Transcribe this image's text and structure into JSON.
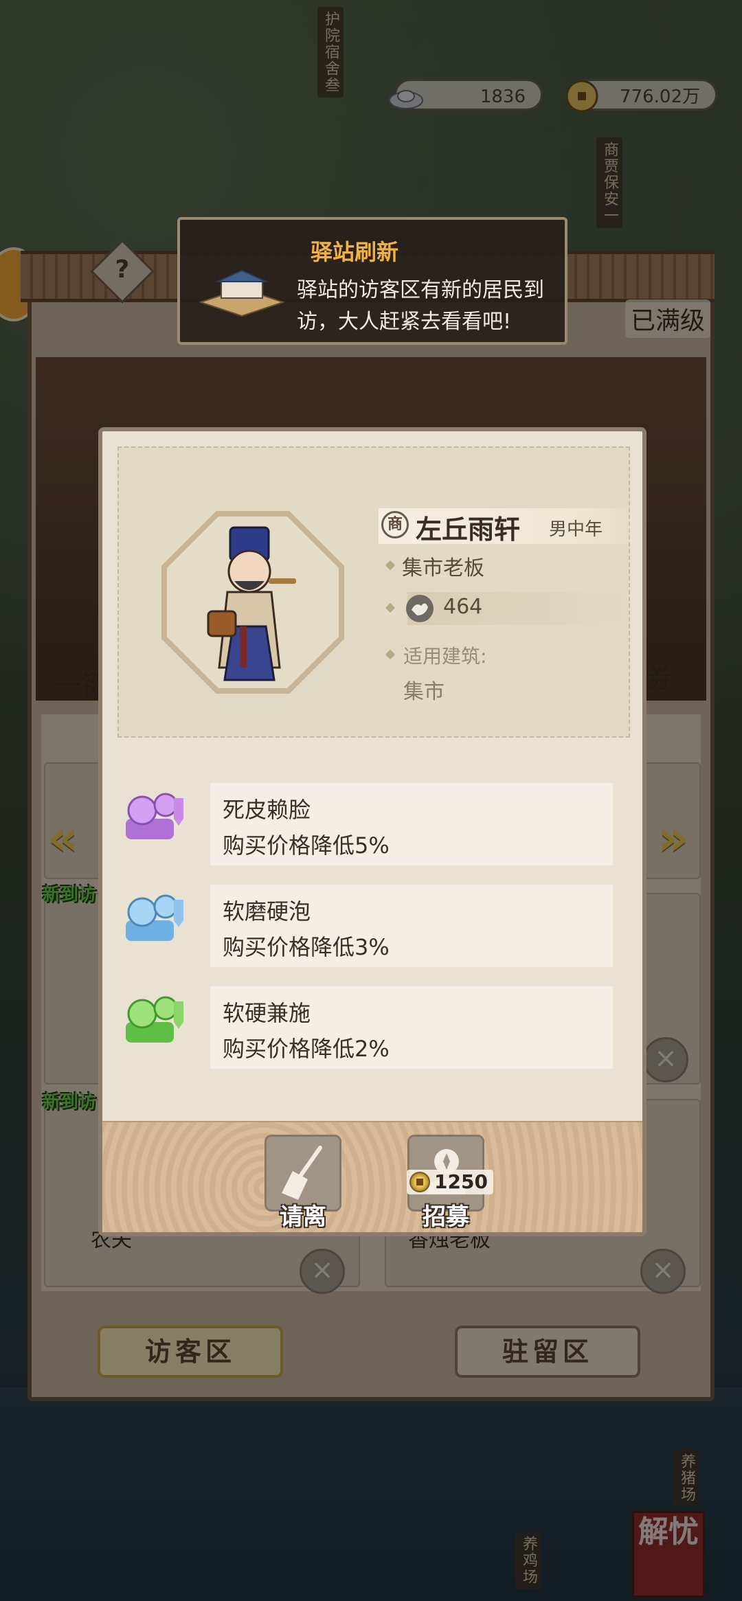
{
  "map": {
    "labels": {
      "guard_dorm": "护院宿舍叁",
      "merchant_security": "商贾保安一",
      "pig_farm": "养猪场",
      "chicken_farm": "养鸡场"
    },
    "corner_logo": "解忧"
  },
  "currency": {
    "silver": "1836",
    "copper": "776.02万"
  },
  "notification": {
    "title": "驿站刷新",
    "text": "驿站的访客区有新的居民到访，大人赶紧去看看吧!"
  },
  "panel": {
    "help": "?",
    "max_level": "已满级",
    "left_partial": "一键",
    "right_partial": "券",
    "new_badge": "新到访",
    "slot_left_label": "农夫",
    "slot_right_label": "香烛老板",
    "tabs": [
      {
        "label": "访客区",
        "active": true
      },
      {
        "label": "驻留区",
        "active": false
      }
    ]
  },
  "visitor": {
    "seal": "商",
    "name": "左丘雨轩",
    "tag": "男中年",
    "occupation": "集市老板",
    "power": "464",
    "building_label": "适用建筑:",
    "building": "集市",
    "traits": [
      {
        "name": "死皮赖脸",
        "desc": "购买价格降低5%",
        "color": "#c98be6"
      },
      {
        "name": "软磨硬泡",
        "desc": "购买价格降低3%",
        "color": "#8fc4ef"
      },
      {
        "name": "软硬兼施",
        "desc": "购买价格降低2%",
        "color": "#8ad46a"
      }
    ],
    "actions": {
      "dismiss": "请离",
      "recruit": "招募",
      "recruit_cost": "1250"
    }
  }
}
